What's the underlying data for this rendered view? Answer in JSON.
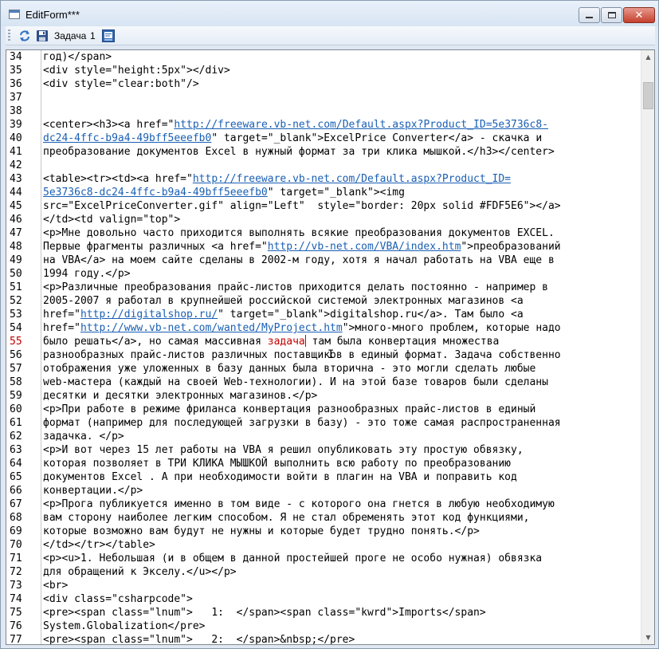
{
  "window": {
    "title": "EditForm***"
  },
  "toolbar": {
    "task_label": "Задача",
    "task_number": "1",
    "icons": [
      "refresh-icon",
      "save-icon",
      "page-icon"
    ]
  },
  "editor": {
    "current_line": 55,
    "lines": [
      {
        "n": "34",
        "parts": [
          {
            "t": "год)</span>"
          }
        ]
      },
      {
        "n": "35",
        "parts": [
          {
            "t": "<div style=\"height:5px\"></div>"
          }
        ]
      },
      {
        "n": "36",
        "parts": [
          {
            "t": "<div style=\"clear:both\"/>"
          }
        ]
      },
      {
        "n": "37",
        "parts": [
          {
            "t": ""
          }
        ]
      },
      {
        "n": "38",
        "parts": [
          {
            "t": ""
          }
        ]
      },
      {
        "n": "39",
        "parts": [
          {
            "t": "<center><h3><a href=\""
          },
          {
            "t": "http://freeware.vb-net.com/Default.aspx?Product_ID=5e3736c8-",
            "link": true
          }
        ]
      },
      {
        "n": "40",
        "parts": [
          {
            "t": "dc24-4ffc-b9a4-49bff5eeefb0",
            "link": true
          },
          {
            "t": "\" target=\"_blank\">ExcelPrice Converter</a> - скачка и"
          }
        ]
      },
      {
        "n": "41",
        "parts": [
          {
            "t": "преобразование документов Excel в нужный формат за три клика мышкой.</h3></center>"
          }
        ]
      },
      {
        "n": "42",
        "parts": [
          {
            "t": ""
          }
        ]
      },
      {
        "n": "43",
        "parts": [
          {
            "t": "<table><tr><td><a href=\""
          },
          {
            "t": "http://freeware.vb-net.com/Default.aspx?Product_ID=",
            "link": true
          }
        ]
      },
      {
        "n": "44",
        "parts": [
          {
            "t": "5e3736c8-dc24-4ffc-b9a4-49bff5eeefb0",
            "link": true
          },
          {
            "t": "\" target=\"_blank\"><img"
          }
        ]
      },
      {
        "n": "45",
        "parts": [
          {
            "t": "src=\"ExcelPriceConverter.gif\" align=\"Left\"  style=\"border: 20px solid #FDF5E6\"></a>"
          }
        ]
      },
      {
        "n": "46",
        "parts": [
          {
            "t": "</td><td valign=\"top\">"
          }
        ]
      },
      {
        "n": "47",
        "parts": [
          {
            "t": "<p>Мне довольно часто приходится выполнять всякие преобразования документов EXCEL."
          }
        ]
      },
      {
        "n": "48",
        "parts": [
          {
            "t": "Первые фрагменты различных <a href=\""
          },
          {
            "t": "http://vb-net.com/VBA/index.htm",
            "link": true
          },
          {
            "t": "\">преобразований"
          }
        ]
      },
      {
        "n": "49",
        "parts": [
          {
            "t": "на VBA</a> на моем сайте сделаны в 2002-м году, хотя я начал работать на VBA еще в"
          }
        ]
      },
      {
        "n": "50",
        "parts": [
          {
            "t": "1994 году.</p>"
          }
        ]
      },
      {
        "n": "51",
        "parts": [
          {
            "t": "<p>Различные преобразования прайс-листов приходится делать постоянно - например в"
          }
        ]
      },
      {
        "n": "52",
        "parts": [
          {
            "t": "2005-2007 я работал в крупнейшей российской системой электронных магазинов <a"
          }
        ]
      },
      {
        "n": "53",
        "parts": [
          {
            "t": "href=\""
          },
          {
            "t": "http://digitalshop.ru/",
            "link": true
          },
          {
            "t": "\" target=\"_blank\">digitalshop.ru</a>. Там было <a"
          }
        ]
      },
      {
        "n": "54",
        "parts": [
          {
            "t": "href=\""
          },
          {
            "t": "http://www.vb-net.com/wanted/MyProject.htm",
            "link": true
          },
          {
            "t": "\">много-много проблем, которые надо"
          }
        ]
      },
      {
        "n": "55",
        "parts": [
          {
            "t": "было решать</a>, но самая массивная "
          },
          {
            "t": "задача",
            "sel": true
          },
          {
            "t": "",
            "caret": true
          },
          {
            "t": " там была конвертация множества"
          }
        ]
      },
      {
        "n": "56",
        "parts": [
          {
            "t": "разнообразных прайс-листов различных поставщиков в единый формат. Задача собственно"
          }
        ]
      },
      {
        "n": "57",
        "parts": [
          {
            "t": "отображения уже уложенных в базу данных была вторична - это могли сделать любые"
          }
        ]
      },
      {
        "n": "58",
        "parts": [
          {
            "t": "web-мастера (каждый на своей Web-технологии). И на этой базе товаров были сделаны"
          }
        ]
      },
      {
        "n": "59",
        "parts": [
          {
            "t": "десятки и десятки электронных магазинов.</p>"
          }
        ]
      },
      {
        "n": "60",
        "parts": [
          {
            "t": "<p>При работе в режиме фриланса конвертация разнообразных прайс-листов в единый"
          }
        ]
      },
      {
        "n": "61",
        "parts": [
          {
            "t": "формат (например для последующей загрузки в базу) - это тоже самая распространенная"
          }
        ]
      },
      {
        "n": "62",
        "parts": [
          {
            "t": "задачка. </p>"
          }
        ]
      },
      {
        "n": "63",
        "parts": [
          {
            "t": "<p>И вот через 15 лет работы на VBA я решил опубликовать эту простую обвязку,"
          }
        ]
      },
      {
        "n": "64",
        "parts": [
          {
            "t": "которая позволяет в ТРИ КЛИКА МЫШКОЙ выполнить всю работу по преобразованию"
          }
        ]
      },
      {
        "n": "65",
        "parts": [
          {
            "t": "документов Excel . А при необходимости войти в плагин на VBA и поправить код"
          }
        ]
      },
      {
        "n": "66",
        "parts": [
          {
            "t": "конвертации.</p>"
          }
        ]
      },
      {
        "n": "67",
        "parts": [
          {
            "t": "<p>Прога публикуется именно в том виде - с которого она гнется в любую необходимую"
          }
        ]
      },
      {
        "n": "68",
        "parts": [
          {
            "t": "вам сторону наиболее легким способом. Я не стал обременять этот код функциями,"
          }
        ]
      },
      {
        "n": "69",
        "parts": [
          {
            "t": "которые возможно вам будут не нужны и которые будет трудно понять.</p>"
          }
        ]
      },
      {
        "n": "70",
        "parts": [
          {
            "t": "</td></tr></table>"
          }
        ]
      },
      {
        "n": "71",
        "parts": [
          {
            "t": "<p><u>1. Небольшая (и в общем в данной простейшей проге не особо нужная) обвязка"
          }
        ]
      },
      {
        "n": "72",
        "parts": [
          {
            "t": "для обращений к Экселу.</u></p>"
          }
        ]
      },
      {
        "n": "73",
        "parts": [
          {
            "t": "<br>"
          }
        ]
      },
      {
        "n": "74",
        "parts": [
          {
            "t": "<div class=\"csharpcode\">"
          }
        ]
      },
      {
        "n": "75",
        "parts": [
          {
            "t": "<pre><span class=\"lnum\">   1:  </span><span class=\"kwrd\">Imports</span>"
          }
        ]
      },
      {
        "n": "76",
        "parts": [
          {
            "t": "System.Globalization</pre>"
          }
        ]
      },
      {
        "n": "77",
        "parts": [
          {
            "t": "<pre><span class=\"lnum\">   2:  </span>&nbsp;</pre>"
          }
        ]
      }
    ]
  }
}
